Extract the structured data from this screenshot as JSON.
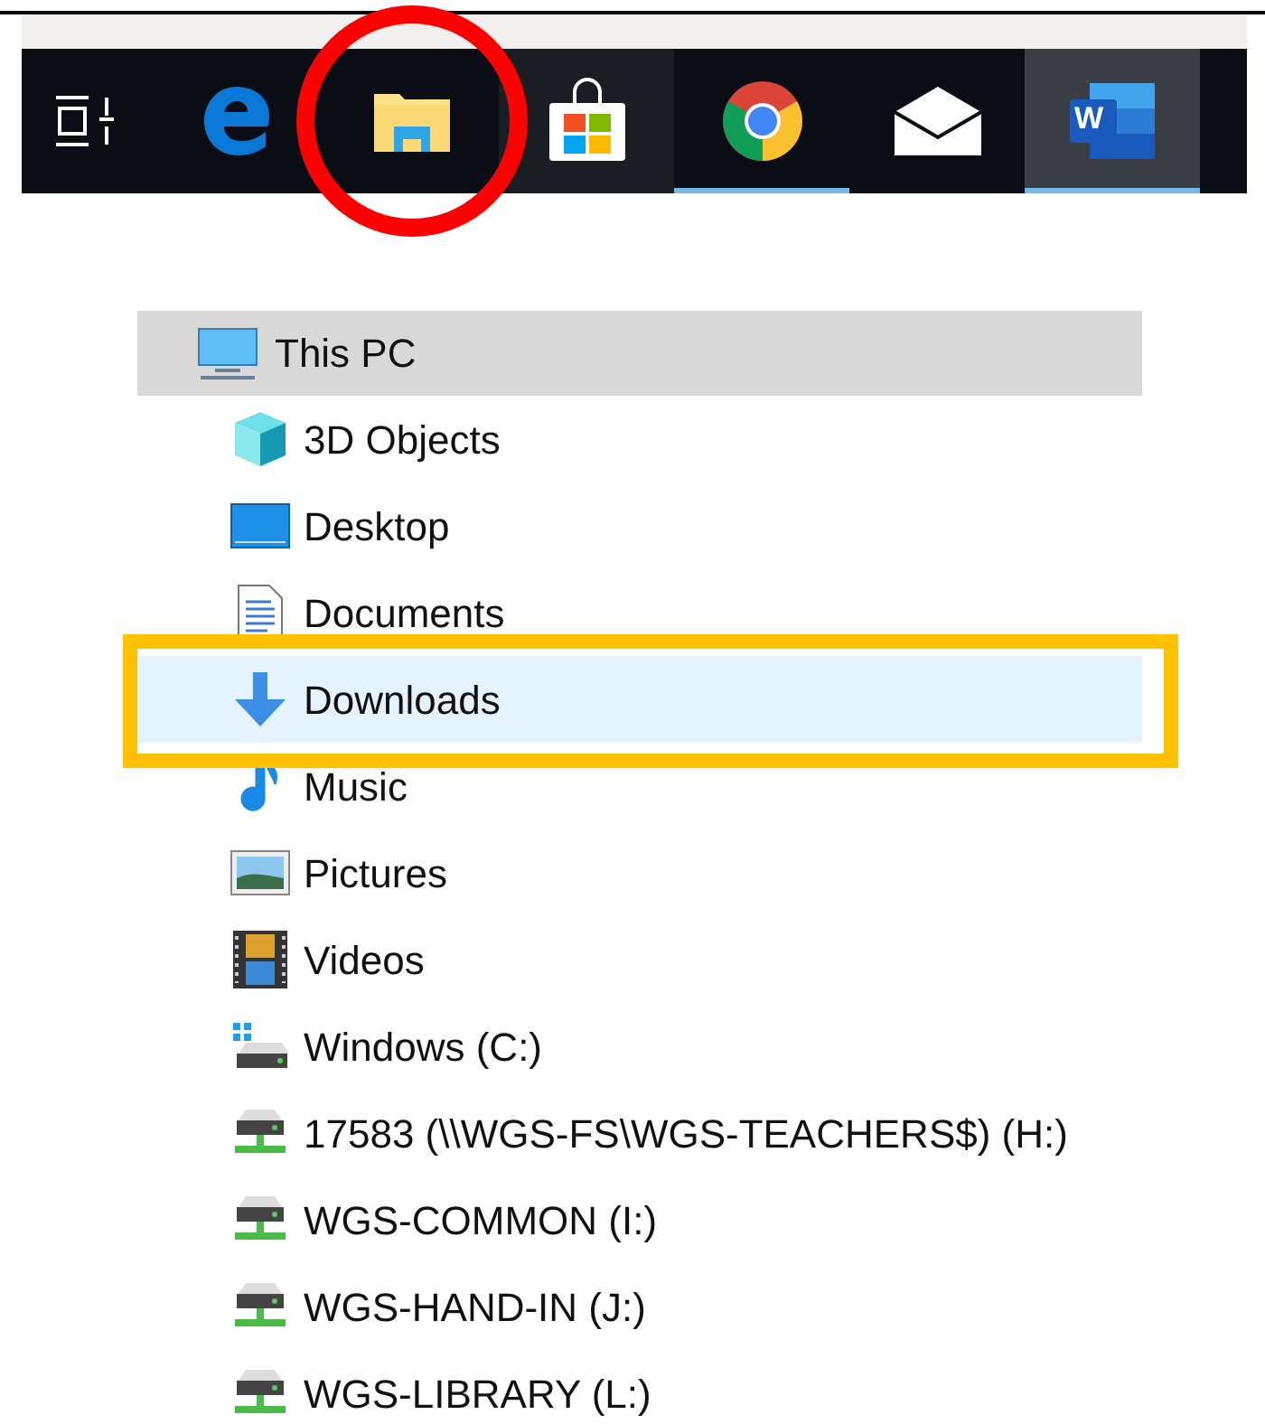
{
  "taskbar": {
    "items": [
      {
        "kind": "task-view",
        "running": false,
        "selected": false,
        "circled": false
      },
      {
        "kind": "edge",
        "running": false,
        "selected": false,
        "circled": false
      },
      {
        "kind": "explorer",
        "running": false,
        "selected": false,
        "circled": true
      },
      {
        "kind": "store",
        "running": false,
        "selected": false,
        "circled": false
      },
      {
        "kind": "chrome",
        "running": true,
        "selected": false,
        "circled": false
      },
      {
        "kind": "mail",
        "running": false,
        "selected": false,
        "circled": false
      },
      {
        "kind": "word",
        "running": true,
        "selected": true,
        "circled": false,
        "glyph": "W"
      }
    ]
  },
  "tree": {
    "label": "This PC",
    "kind": "pc",
    "selected": true,
    "children": [
      {
        "label": "3D Objects",
        "kind": "cube",
        "highlighted": false,
        "outlined": false
      },
      {
        "label": "Desktop",
        "kind": "desktop",
        "highlighted": false,
        "outlined": false
      },
      {
        "label": "Documents",
        "kind": "document",
        "highlighted": false,
        "outlined": false
      },
      {
        "label": "Downloads",
        "kind": "download",
        "highlighted": true,
        "outlined": true
      },
      {
        "label": "Music",
        "kind": "music",
        "highlighted": false,
        "outlined": false
      },
      {
        "label": "Pictures",
        "kind": "pictures",
        "highlighted": false,
        "outlined": false
      },
      {
        "label": "Videos",
        "kind": "videos",
        "highlighted": false,
        "outlined": false
      },
      {
        "label": "Windows (C:)",
        "kind": "drive-windows",
        "highlighted": false,
        "outlined": false
      },
      {
        "label": "17583 (\\\\WGS-FS\\WGS-TEACHERS$) (H:)",
        "kind": "drive-network",
        "highlighted": false,
        "outlined": false
      },
      {
        "label": "WGS-COMMON (I:)",
        "kind": "drive-network",
        "highlighted": false,
        "outlined": false
      },
      {
        "label": "WGS-HAND-IN (J:)",
        "kind": "drive-network",
        "highlighted": false,
        "outlined": false
      },
      {
        "label": "WGS-LIBRARY (L:)",
        "kind": "drive-network",
        "highlighted": false,
        "outlined": false
      }
    ]
  }
}
